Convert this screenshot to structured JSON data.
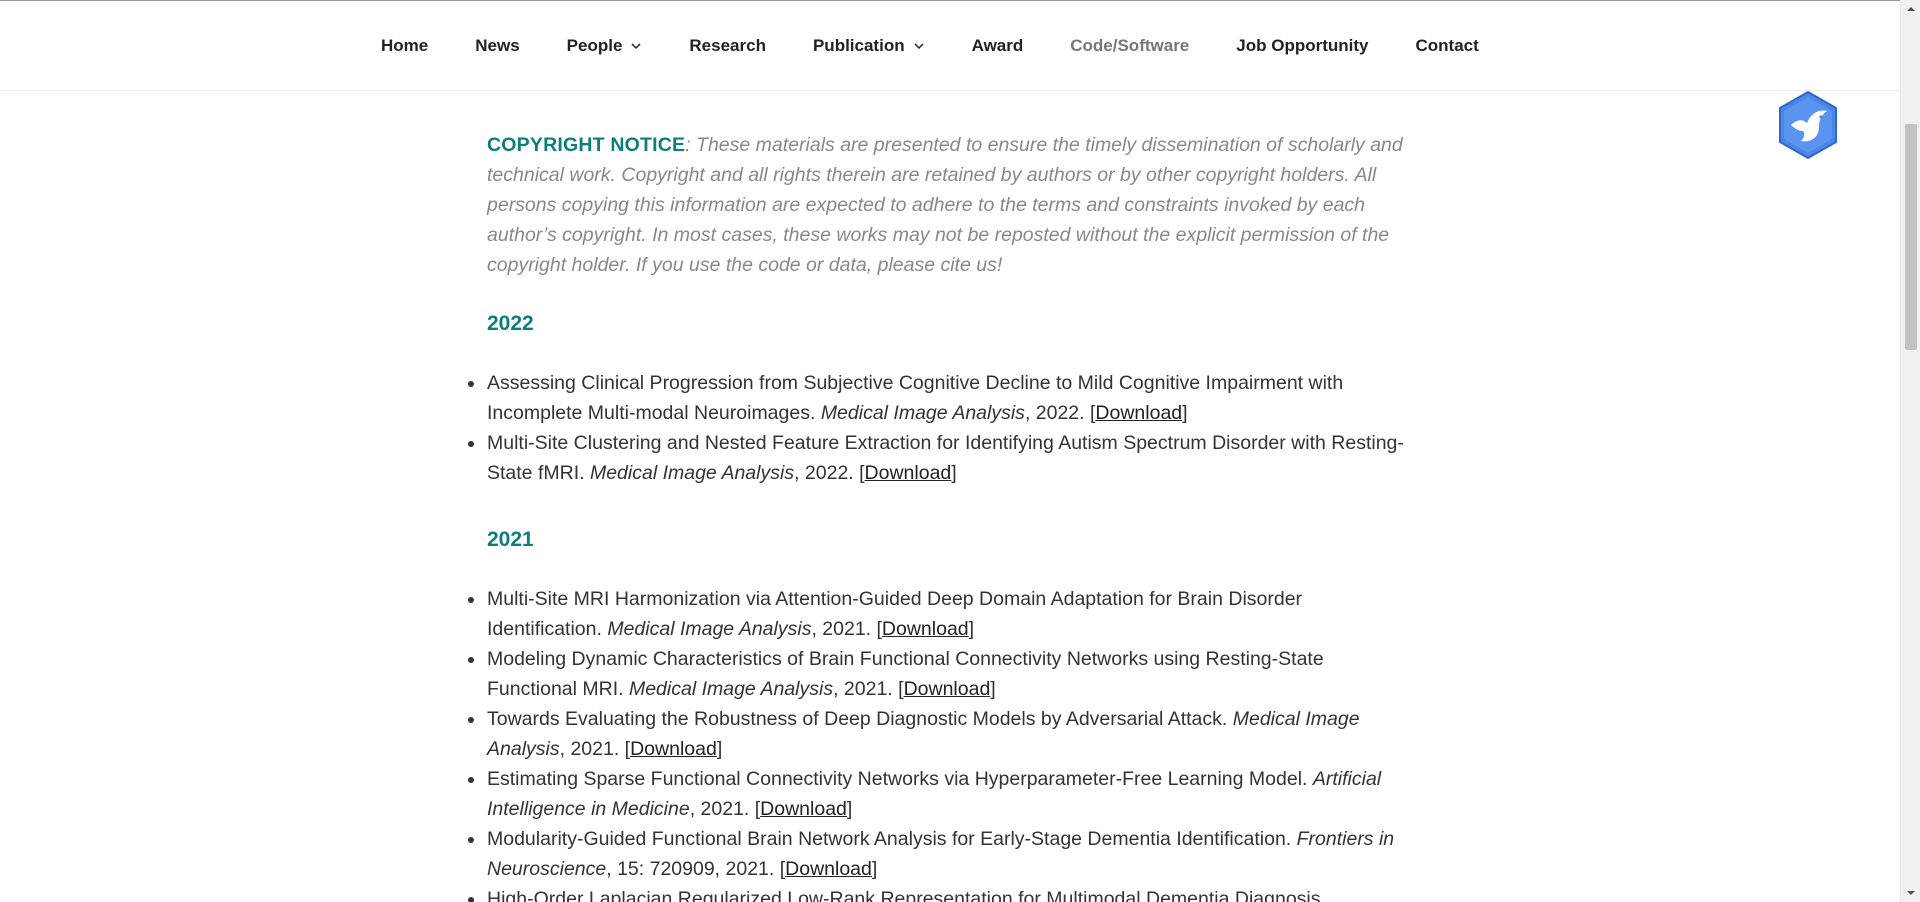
{
  "nav": {
    "items": [
      {
        "label": "Home"
      },
      {
        "label": "News"
      },
      {
        "label": "People"
      },
      {
        "label": "Research"
      },
      {
        "label": "Publication"
      },
      {
        "label": "Award"
      },
      {
        "label": "Code/Software"
      },
      {
        "label": "Job Opportunity"
      },
      {
        "label": "Contact"
      }
    ],
    "active": "Code/Software"
  },
  "notice": {
    "title": "COPYRIGHT NOTICE",
    "text": ": These materials are presented to ensure the timely dissemination of scholarly and technical work. Copyright and all rights therein are retained by authors or by other copyright holders. All persons copying this information are expected to adhere to the terms and constraints invoked by each author’s copyright. In most cases, these works may not be reposted without the explicit permission of the copyright holder. If you use the code or data, please cite us!"
  },
  "sections": [
    {
      "year": "2022",
      "pubs": [
        {
          "title": "Assessing Clinical Progression from Subjective Cognitive Decline to Mild Cognitive Impairment with Incomplete Multi-modal Neuroimages. ",
          "venue": "Medical Image Analysis",
          "rest": ", 2022. [",
          "link": "Download",
          "close": "]"
        },
        {
          "title": "Multi-Site Clustering and Nested Feature Extraction for Identifying Autism Spectrum Disorder with Resting-State fMRI. ",
          "venue": "Medical Image Analysis",
          "rest": ", 2022. [",
          "link": "Download",
          "close": "]"
        }
      ]
    },
    {
      "year": "2021",
      "pubs": [
        {
          "title": "Multi-Site MRI Harmonization via Attention-Guided Deep Domain Adaptation for Brain Disorder Identification. ",
          "venue": "Medical Image Analysis",
          "rest": ", 2021. [",
          "link": "Download",
          "close": "]"
        },
        {
          "title": "Modeling Dynamic Characteristics of Brain Functional Connectivity Networks using Resting-State Functional MRI. ",
          "venue": "Medical Image Analysis",
          "rest": ", 2021. [",
          "link": "Download",
          "close": "]"
        },
        {
          "title": "Towards Evaluating the Robustness of Deep Diagnostic Models by Adversarial Attack. ",
          "venue": "Medical Image Analysis",
          "rest": ", 2021. [",
          "link": "Download",
          "close": "]"
        },
        {
          "title": "Estimating Sparse Functional Connectivity Networks via Hyperparameter-Free Learning Model. ",
          "venue": "Artificial Intelligence in Medicine",
          "rest": ", 2021. [",
          "link": "Download",
          "close": "]"
        },
        {
          "title": "Modularity-Guided Functional Brain Network Analysis for Early-Stage Dementia Identification. ",
          "venue": "Frontiers in Neuroscience",
          "rest": ", 15: 720909, 2021. [",
          "link": "Download",
          "close": "]"
        },
        {
          "title": "High-Order Laplacian Regularized Low-Rank Representation for Multimodal Dementia Diagnosis.",
          "venue": "",
          "rest": "",
          "link": "",
          "close": ""
        }
      ]
    }
  ],
  "icons": {
    "dropdown": "chevron-down-icon",
    "badge": "bird-hexagon-icon",
    "scroll_up": "arrow-up-icon",
    "scroll_down": "arrow-down-icon"
  },
  "colors": {
    "accent": "#0e7d7d",
    "notice_text": "#888888",
    "nav_active": "#767676",
    "badge_blue": "#4a86e8"
  }
}
